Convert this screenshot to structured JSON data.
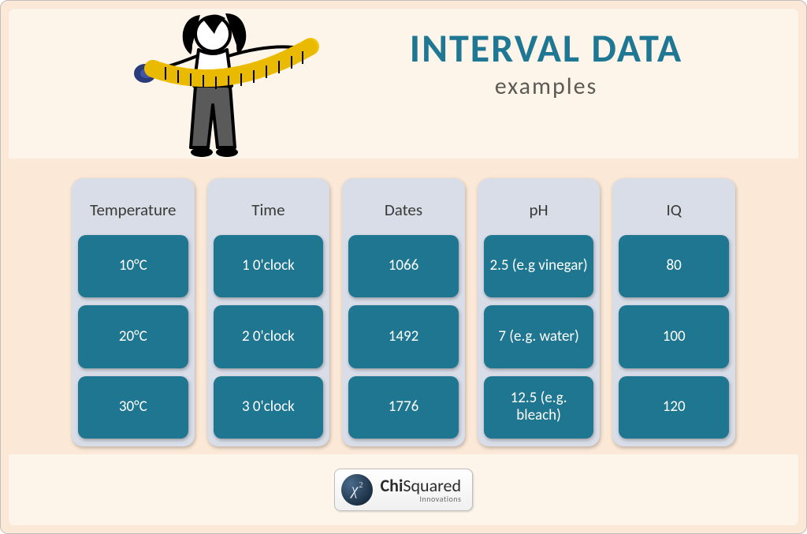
{
  "title": "INTERVAL DATA",
  "subtitle": "examples",
  "columns": [
    {
      "header": "Temperature",
      "items": [
        "10°C",
        "20°C",
        "30°C"
      ]
    },
    {
      "header": "Time",
      "items": [
        "1 0'clock",
        "2 0'clock",
        "3 0'clock"
      ]
    },
    {
      "header": "Dates",
      "items": [
        "1066",
        "1492",
        "1776"
      ]
    },
    {
      "header": "pH",
      "items": [
        "2.5 (e.g vinegar)",
        "7 (e.g. water)",
        "12.5 (e.g. bleach)"
      ]
    },
    {
      "header": "IQ",
      "items": [
        "80",
        "100",
        "120"
      ]
    }
  ],
  "logo": {
    "mark_text": "χ",
    "mark_sup": "2",
    "name_strong": "Chi",
    "name_rest": "Squared",
    "tagline": "Innovations"
  }
}
